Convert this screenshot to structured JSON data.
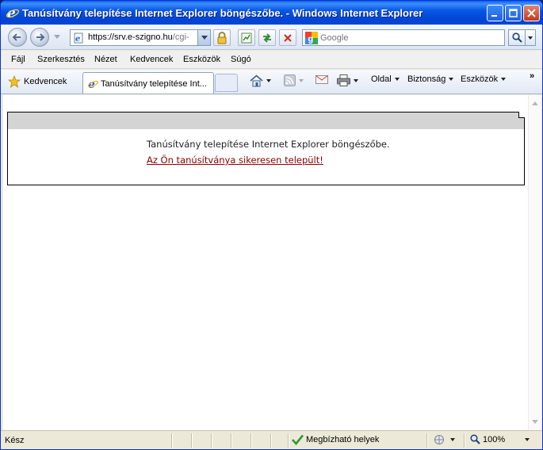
{
  "window": {
    "title": "Tanúsítvány telepítése Internet Explorer böngészőbe. - Windows Internet Explorer"
  },
  "address": {
    "url_main": "https://srv.e-szigno.hu",
    "url_rest": "/cgi-"
  },
  "search": {
    "placeholder": "Google"
  },
  "menu": {
    "items": [
      "Fájl",
      "Szerkesztés",
      "Nézet",
      "Kedvencek",
      "Eszközök",
      "Súgó"
    ]
  },
  "commandbar": {
    "favorites_label": "Kedvencek",
    "tab_label": "Tanúsítvány telepítése Int...",
    "page_label": "Oldal",
    "security_label": "Biztonság",
    "tools_label": "Eszközök",
    "more_label": "»"
  },
  "content": {
    "message": "Tanúsítvány telepítése Internet Explorer böngészőbe.",
    "success_link": "Az Ön tanúsítványa sikeresen települt!"
  },
  "status": {
    "text": "Kész",
    "zone": "Megbízható helyek",
    "zoom": "100%"
  },
  "colors": {
    "title_bar": "#0446d7",
    "link": "#8b0000",
    "panel_header": "#d4d4d4"
  }
}
